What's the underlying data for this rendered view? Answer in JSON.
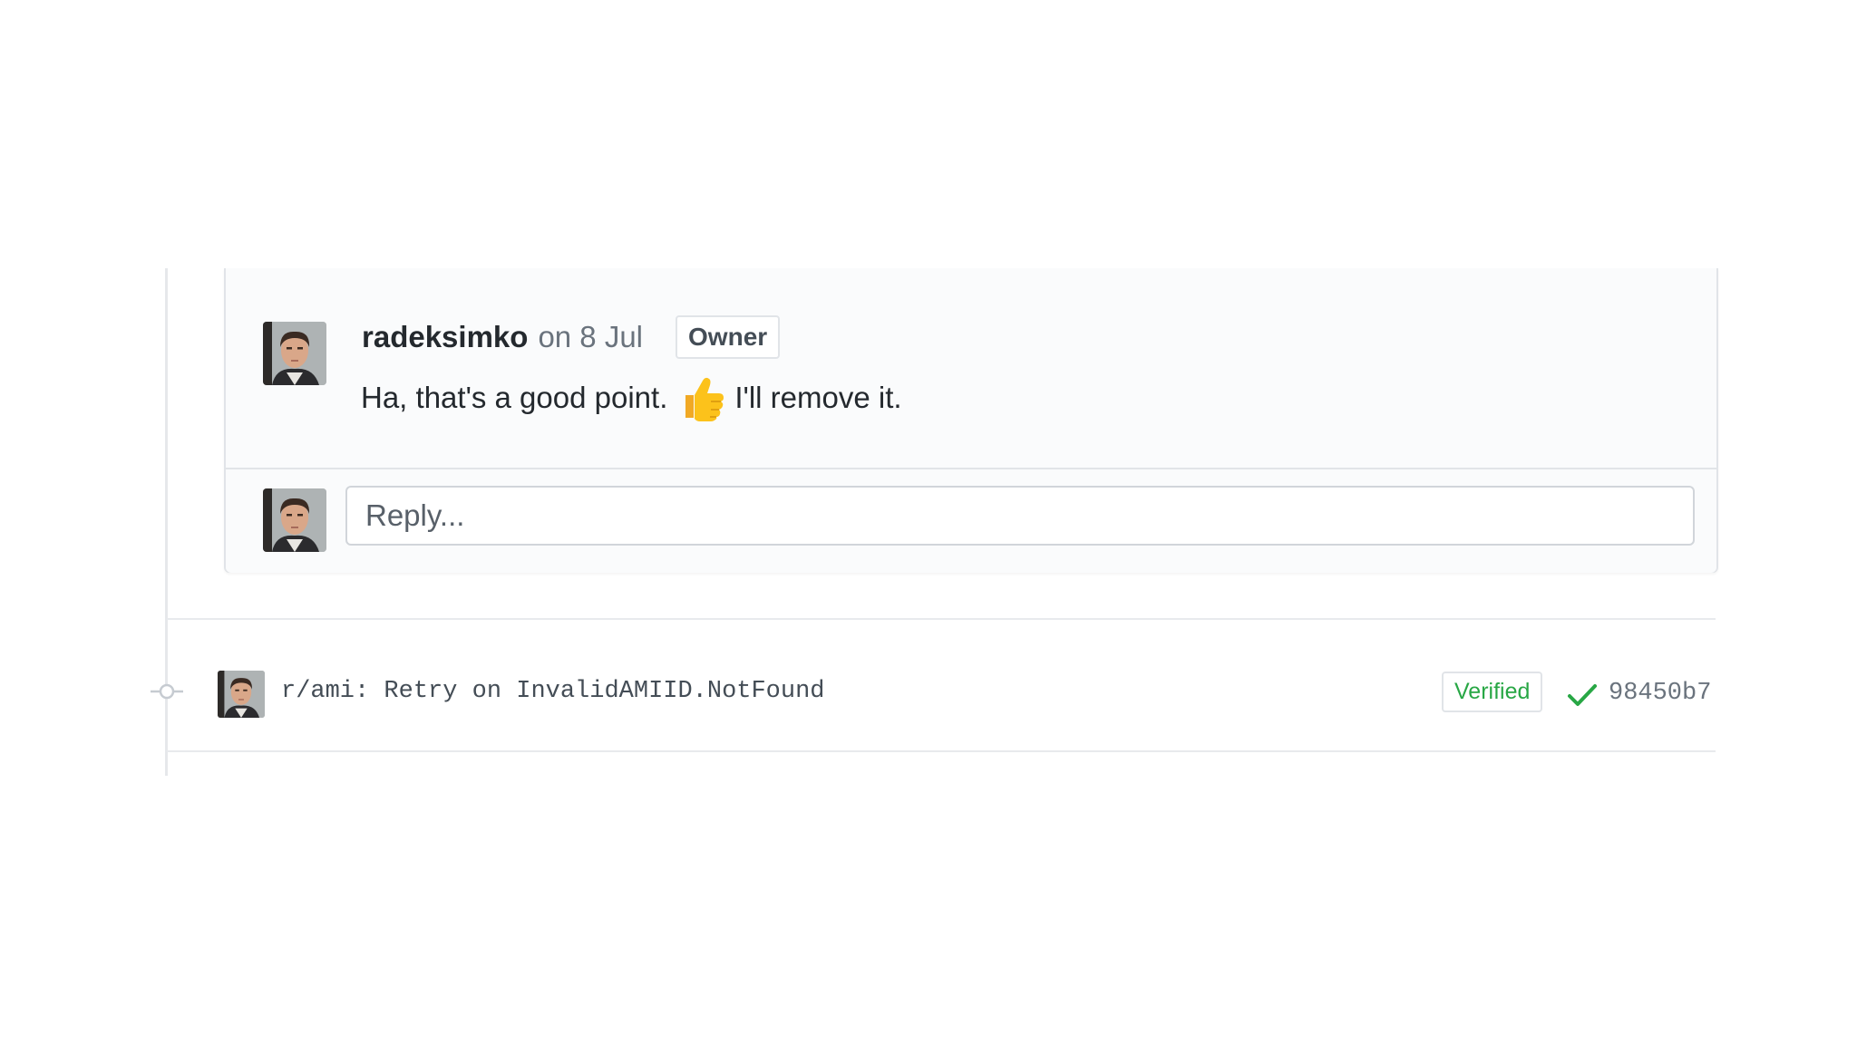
{
  "comment": {
    "author": "radeksimko",
    "date": "on 8 Jul",
    "badge": "Owner",
    "body_before": "Ha, that's a good point.",
    "emoji": "thumbs-up-icon",
    "body_after": "I'll remove it."
  },
  "reply": {
    "placeholder": "Reply..."
  },
  "commit": {
    "message": "r/ami: Retry on InvalidAMIID.NotFound",
    "verified_label": "Verified",
    "sha": "98450b7",
    "status_icon": "check-icon"
  },
  "colors": {
    "verified_green": "#28a745",
    "border": "#e1e4e8",
    "muted_text": "#6a737d"
  }
}
